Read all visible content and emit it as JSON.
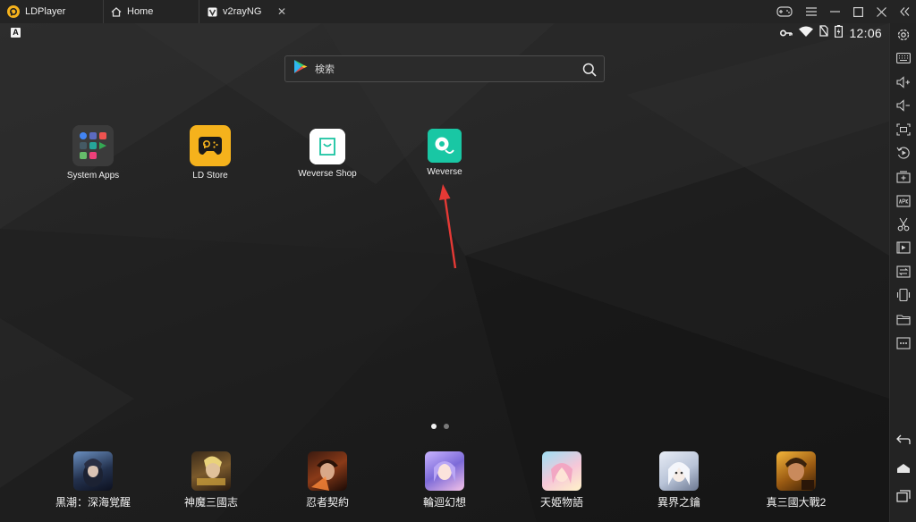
{
  "window": {
    "app_name": "LDPlayer",
    "tabs": [
      {
        "label": "Home",
        "icon": "home-icon"
      },
      {
        "label": "v2rayNG",
        "icon": "v2rayng-icon",
        "close": "✕"
      }
    ],
    "controls": [
      "gamepad-icon",
      "menu-icon",
      "minimize-icon",
      "maximize-icon",
      "close-icon",
      "collapse-sidebar-icon"
    ]
  },
  "status_bar": {
    "left_badge": "A",
    "icons": [
      "vpn-key-icon",
      "wifi-icon",
      "no-sim-icon",
      "battery-charging-icon"
    ],
    "time": "12:06"
  },
  "search": {
    "placeholder": "検索",
    "icon": "search-icon"
  },
  "home_apps": [
    {
      "label": "System Apps",
      "icon": "system-apps-icon"
    },
    {
      "label": "LD Store",
      "icon": "ld-store-icon"
    },
    {
      "label": "Weverse Shop",
      "icon": "weverse-shop-icon"
    },
    {
      "label": "Weverse",
      "icon": "weverse-icon"
    }
  ],
  "annotation": {
    "type": "arrow",
    "color": "#e53935",
    "target": "Weverse"
  },
  "page_indicator": {
    "pages": 2,
    "current": 1
  },
  "dock_apps": [
    {
      "label": "黒潮：深海覚醒"
    },
    {
      "label": "神魔三國志"
    },
    {
      "label": "忍者契約"
    },
    {
      "label": "輪迴幻想"
    },
    {
      "label": "天姫物語"
    },
    {
      "label": "異界之鑰"
    },
    {
      "label": "真三國大戰2"
    }
  ],
  "sidebar_tools": [
    "settings-icon",
    "keyboard-mapping-icon",
    "volume-up-icon",
    "volume-down-icon",
    "screenshot-icon",
    "rotate-icon",
    "add-apk-icon",
    "install-apk-icon",
    "scissors-icon",
    "record-icon",
    "sync-icon",
    "shake-icon",
    "folder-icon",
    "more-icon",
    "back-icon",
    "home-nav-icon",
    "recents-icon"
  ],
  "colors": {
    "titlebar": "#242424",
    "sidebar": "#232323",
    "ld_yellow": "#f5b21c",
    "weverse_teal": "#17c3a1",
    "arrow_red": "#e53935"
  }
}
